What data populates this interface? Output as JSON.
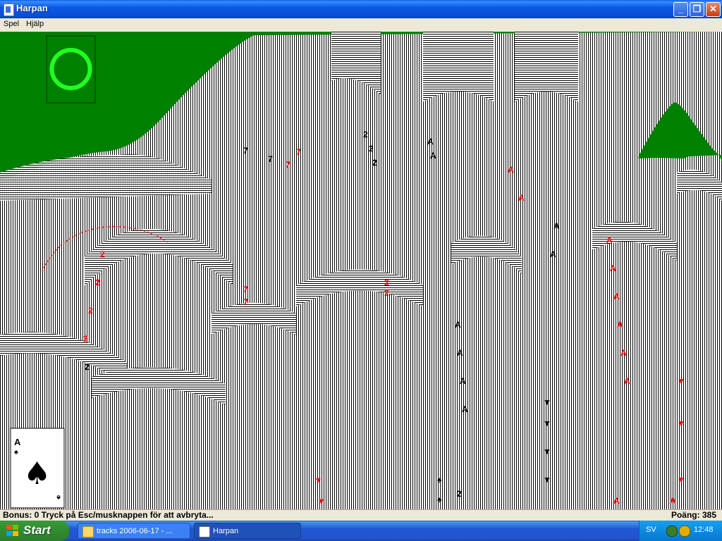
{
  "window": {
    "title": "Harpan"
  },
  "menu": {
    "items": [
      "Spel",
      "Hjälp"
    ]
  },
  "game": {
    "stock_indicator": "circle-icon",
    "foundation_card": {
      "rank": "A",
      "suit": "♠"
    }
  },
  "status": {
    "left": "Bonus: 0  Tryck på Esc/musknappen för att avbryta...",
    "right": "Poäng: 385"
  },
  "taskbar": {
    "start_label": "Start",
    "tasks": [
      {
        "label": "tracks 2006-06-17 - ...",
        "icon": "folder-icon"
      },
      {
        "label": "Harpan",
        "icon": "solitaire-icon"
      }
    ],
    "tray": {
      "language": "SV",
      "time": "12:48"
    }
  },
  "colors": {
    "felt": "#008000",
    "title_blue": "#0a5ae6",
    "card_red": "#ff0000"
  }
}
